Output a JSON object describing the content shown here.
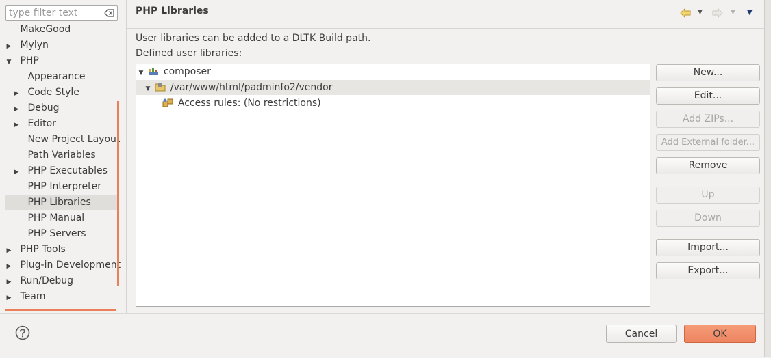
{
  "filter": {
    "placeholder": "type filter text"
  },
  "tree": [
    {
      "label": "MakeGood",
      "expander": ""
    },
    {
      "label": "Mylyn",
      "expander": "▶"
    },
    {
      "label": "PHP",
      "expander": "▼"
    },
    {
      "label": "Appearance",
      "expander": ""
    },
    {
      "label": "Code Style",
      "expander": "▶"
    },
    {
      "label": "Debug",
      "expander": "▶"
    },
    {
      "label": "Editor",
      "expander": "▶"
    },
    {
      "label": "New Project Layout",
      "expander": ""
    },
    {
      "label": "Path Variables",
      "expander": ""
    },
    {
      "label": "PHP Executables",
      "expander": "▶"
    },
    {
      "label": "PHP Interpreter",
      "expander": ""
    },
    {
      "label": "PHP Libraries",
      "expander": ""
    },
    {
      "label": "PHP Manual",
      "expander": ""
    },
    {
      "label": "PHP Servers",
      "expander": ""
    },
    {
      "label": "PHP Tools",
      "expander": "▶"
    },
    {
      "label": "Plug-in Development",
      "expander": "▶"
    },
    {
      "label": "Run/Debug",
      "expander": "▶"
    },
    {
      "label": "Team",
      "expander": "▶"
    }
  ],
  "page": {
    "title": "PHP Libraries",
    "description": "User libraries can be added to a DLTK Build path.",
    "defined_label": "Defined user libraries:"
  },
  "libraries": [
    {
      "label": "composer",
      "expander": "▼"
    },
    {
      "label": "/var/www/html/padminfo2/vendor",
      "expander": "▼"
    },
    {
      "label": "Access rules: (No restrictions)",
      "expander": ""
    }
  ],
  "buttons": {
    "new": "New...",
    "edit": "Edit...",
    "add_zips": "Add ZIPs...",
    "add_external": "Add External folder...",
    "remove": "Remove",
    "up": "Up",
    "down": "Down",
    "import": "Import...",
    "export": "Export..."
  },
  "footer": {
    "cancel": "Cancel",
    "ok": "OK"
  },
  "colors": {
    "accent": "#e9805a",
    "ok_button": "#f08a65"
  },
  "icons": [
    "clear-filter-icon",
    "back-icon",
    "forward-icon",
    "view-menu-icon",
    "library-icon",
    "folder-jar-icon",
    "access-rules-icon",
    "help-icon"
  ]
}
